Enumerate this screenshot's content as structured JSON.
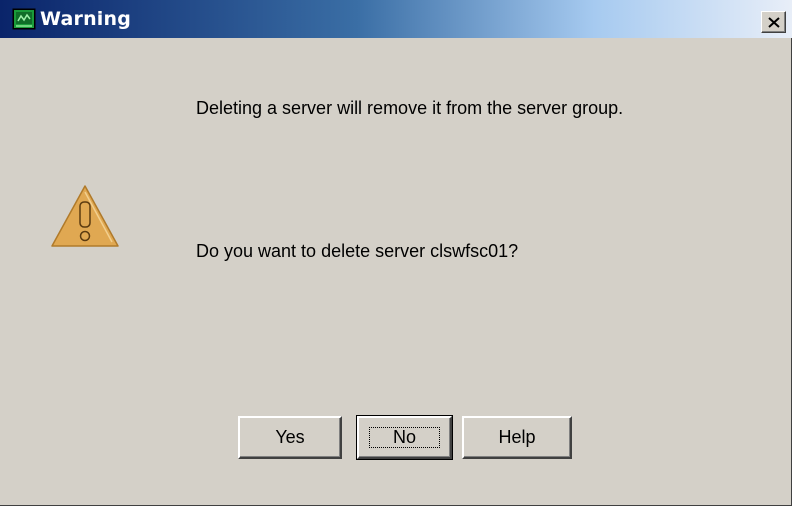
{
  "window": {
    "title": "Warning",
    "close_glyph": "×"
  },
  "message": {
    "line1": "Deleting a server will remove it from the server group.",
    "line2": "Do you want to delete server clswfsc01?"
  },
  "buttons": {
    "yes": "Yes",
    "no": "No",
    "help": "Help",
    "focused": "No"
  },
  "icons": {
    "app": "app-window-icon",
    "warning": "warning-icon",
    "close": "close-icon"
  },
  "colors": {
    "dialog_bg": "#d4d0c8",
    "titlebar_start": "#0a246a",
    "titlebar_end": "#e8eef8",
    "warning_fill": "#e0a852"
  }
}
